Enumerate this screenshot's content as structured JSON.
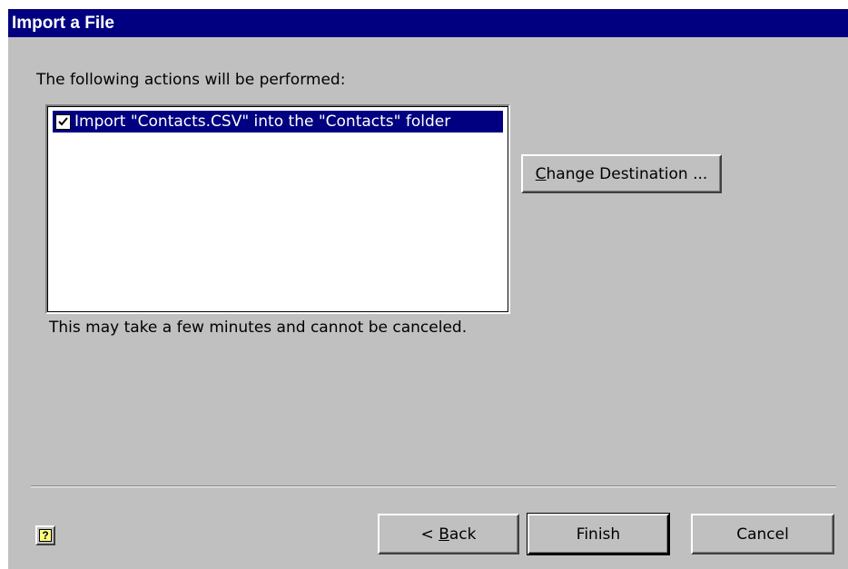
{
  "window": {
    "title": "Import a File"
  },
  "intro_label": "The following actions will be performed:",
  "actions": [
    {
      "checked": true,
      "label": "Import \"Contacts.CSV\" into the \"Contacts\" folder"
    }
  ],
  "buttons": {
    "change_destination": {
      "accel": "C",
      "rest": "hange Destination ..."
    },
    "back": {
      "prefix": "< ",
      "accel": "B",
      "rest": "ack"
    },
    "finish": "Finish",
    "cancel": "Cancel"
  },
  "note": "This may take a few minutes and cannot be canceled.",
  "help_icon": "?",
  "colors": {
    "titlebar": "#000080",
    "dialog": "#c0c0c0",
    "selection": "#000080"
  }
}
